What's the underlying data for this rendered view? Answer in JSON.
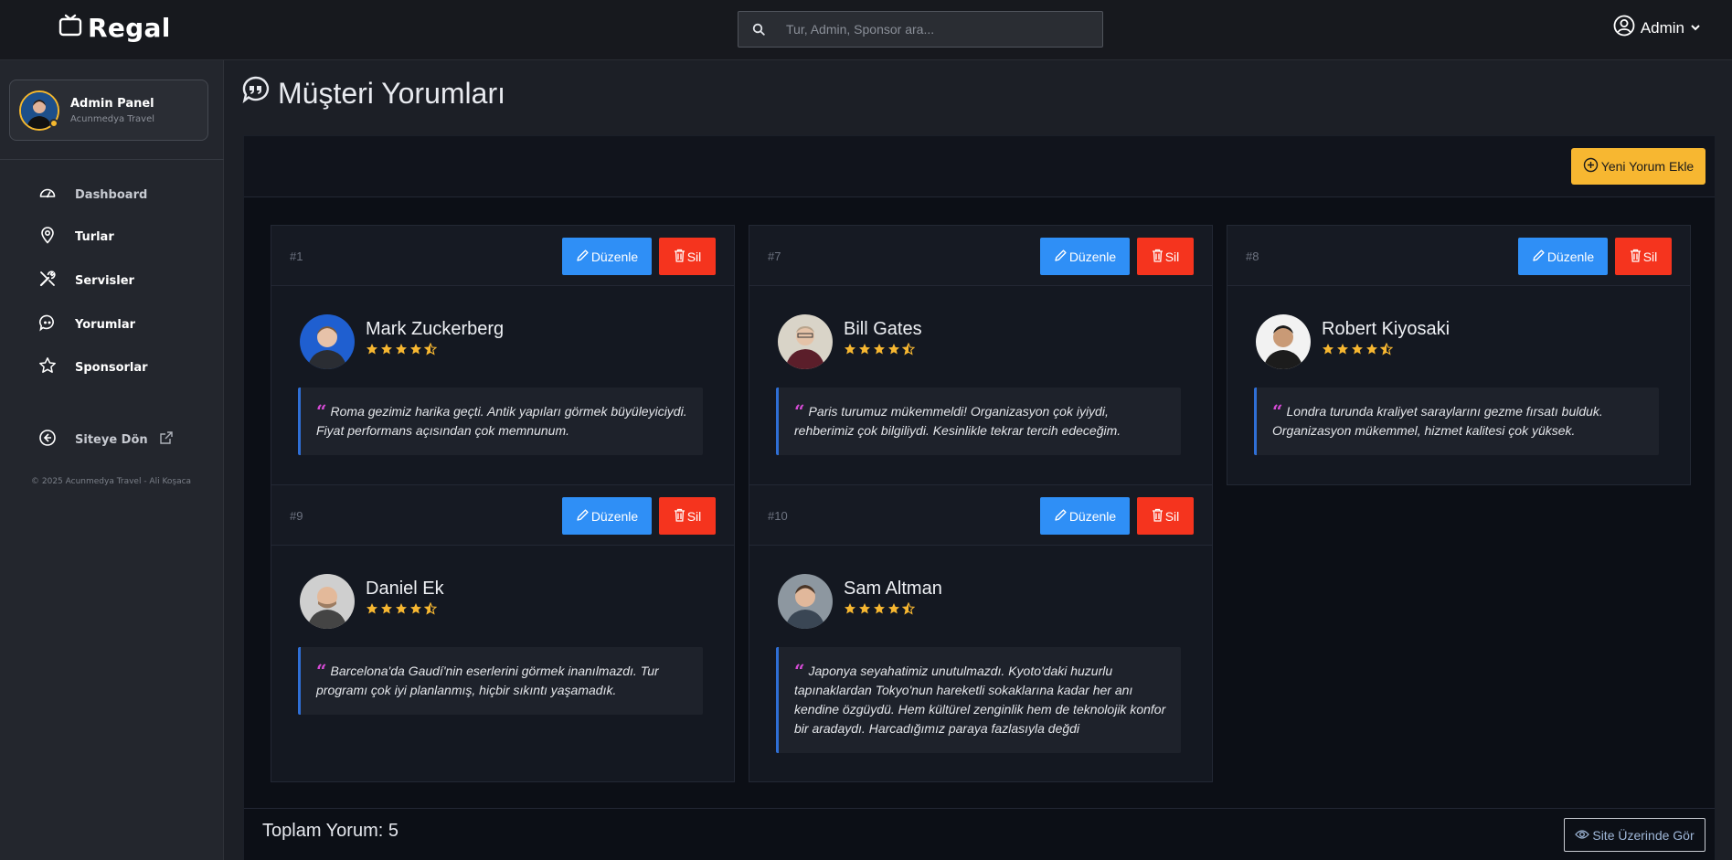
{
  "brand": {
    "name": "Regal"
  },
  "search": {
    "placeholder": "Tur, Admin, Sponsor ara..."
  },
  "user": {
    "label": "Admin"
  },
  "profile": {
    "title": "Admin Panel",
    "subtitle": "Acunmedya Travel"
  },
  "sidebar": {
    "items": [
      {
        "label": "Dashboard",
        "icon": "gauge-icon"
      },
      {
        "label": "Turlar",
        "icon": "map-pin-icon"
      },
      {
        "label": "Servisler",
        "icon": "tools-icon"
      },
      {
        "label": "Yorumlar",
        "icon": "comment-quote-icon"
      },
      {
        "label": "Sponsorlar",
        "icon": "star-outline-icon"
      }
    ],
    "back_label": "Siteye Dön",
    "copyright": "© 2025 Acunmedya Travel - Ali Koşaca"
  },
  "page": {
    "title": "Müşteri Yorumları"
  },
  "toolbar": {
    "add_label": "Yeni Yorum Ekle"
  },
  "actions": {
    "edit_label": "Düzenle",
    "delete_label": "Sil"
  },
  "reviews": [
    {
      "id": "#1",
      "name": "Mark Zuckerberg",
      "rating": 4.5,
      "text": "Roma gezimiz harika geçti. Antik yapıları görmek büyüleyiciydi. Fiyat performans açısından çok memnunum."
    },
    {
      "id": "#7",
      "name": "Bill Gates",
      "rating": 4.5,
      "text": "Paris turumuz mükemmeldi! Organizasyon çok iyiydi, rehberimiz çok bilgiliydi. Kesinlikle tekrar tercih edeceğim."
    },
    {
      "id": "#8",
      "name": "Robert Kiyosaki",
      "rating": 4.5,
      "text": "Londra turunda kraliyet saraylarını gezme fırsatı bulduk. Organizasyon mükemmel, hizmet kalitesi çok yüksek."
    },
    {
      "id": "#9",
      "name": "Daniel Ek",
      "rating": 4.5,
      "text": "Barcelona'da Gaudí'nin eserlerini görmek inanılmazdı. Tur programı çok iyi planlanmış, hiçbir sıkıntı yaşamadık."
    },
    {
      "id": "#10",
      "name": "Sam Altman",
      "rating": 4.5,
      "text": "Japonya seyahatimiz unutulmazdı. Kyoto'daki huzurlu tapınaklardan Tokyo'nun hareketli sokaklarına kadar her anı kendine özgüydü. Hem kültürel zenginlik hem de teknolojik konfor bir aradaydı. Harcadığımız paraya fazlasıyla değdi"
    }
  ],
  "footer": {
    "total_label": "Toplam Yorum: 5",
    "view_site_label": "Site Üzerinde Gör"
  },
  "colors": {
    "accent": "#f7b731",
    "edit": "#2f8ff6",
    "delete": "#f5341e",
    "star": "#f7b731",
    "quote_mark": "#d64bd6"
  }
}
